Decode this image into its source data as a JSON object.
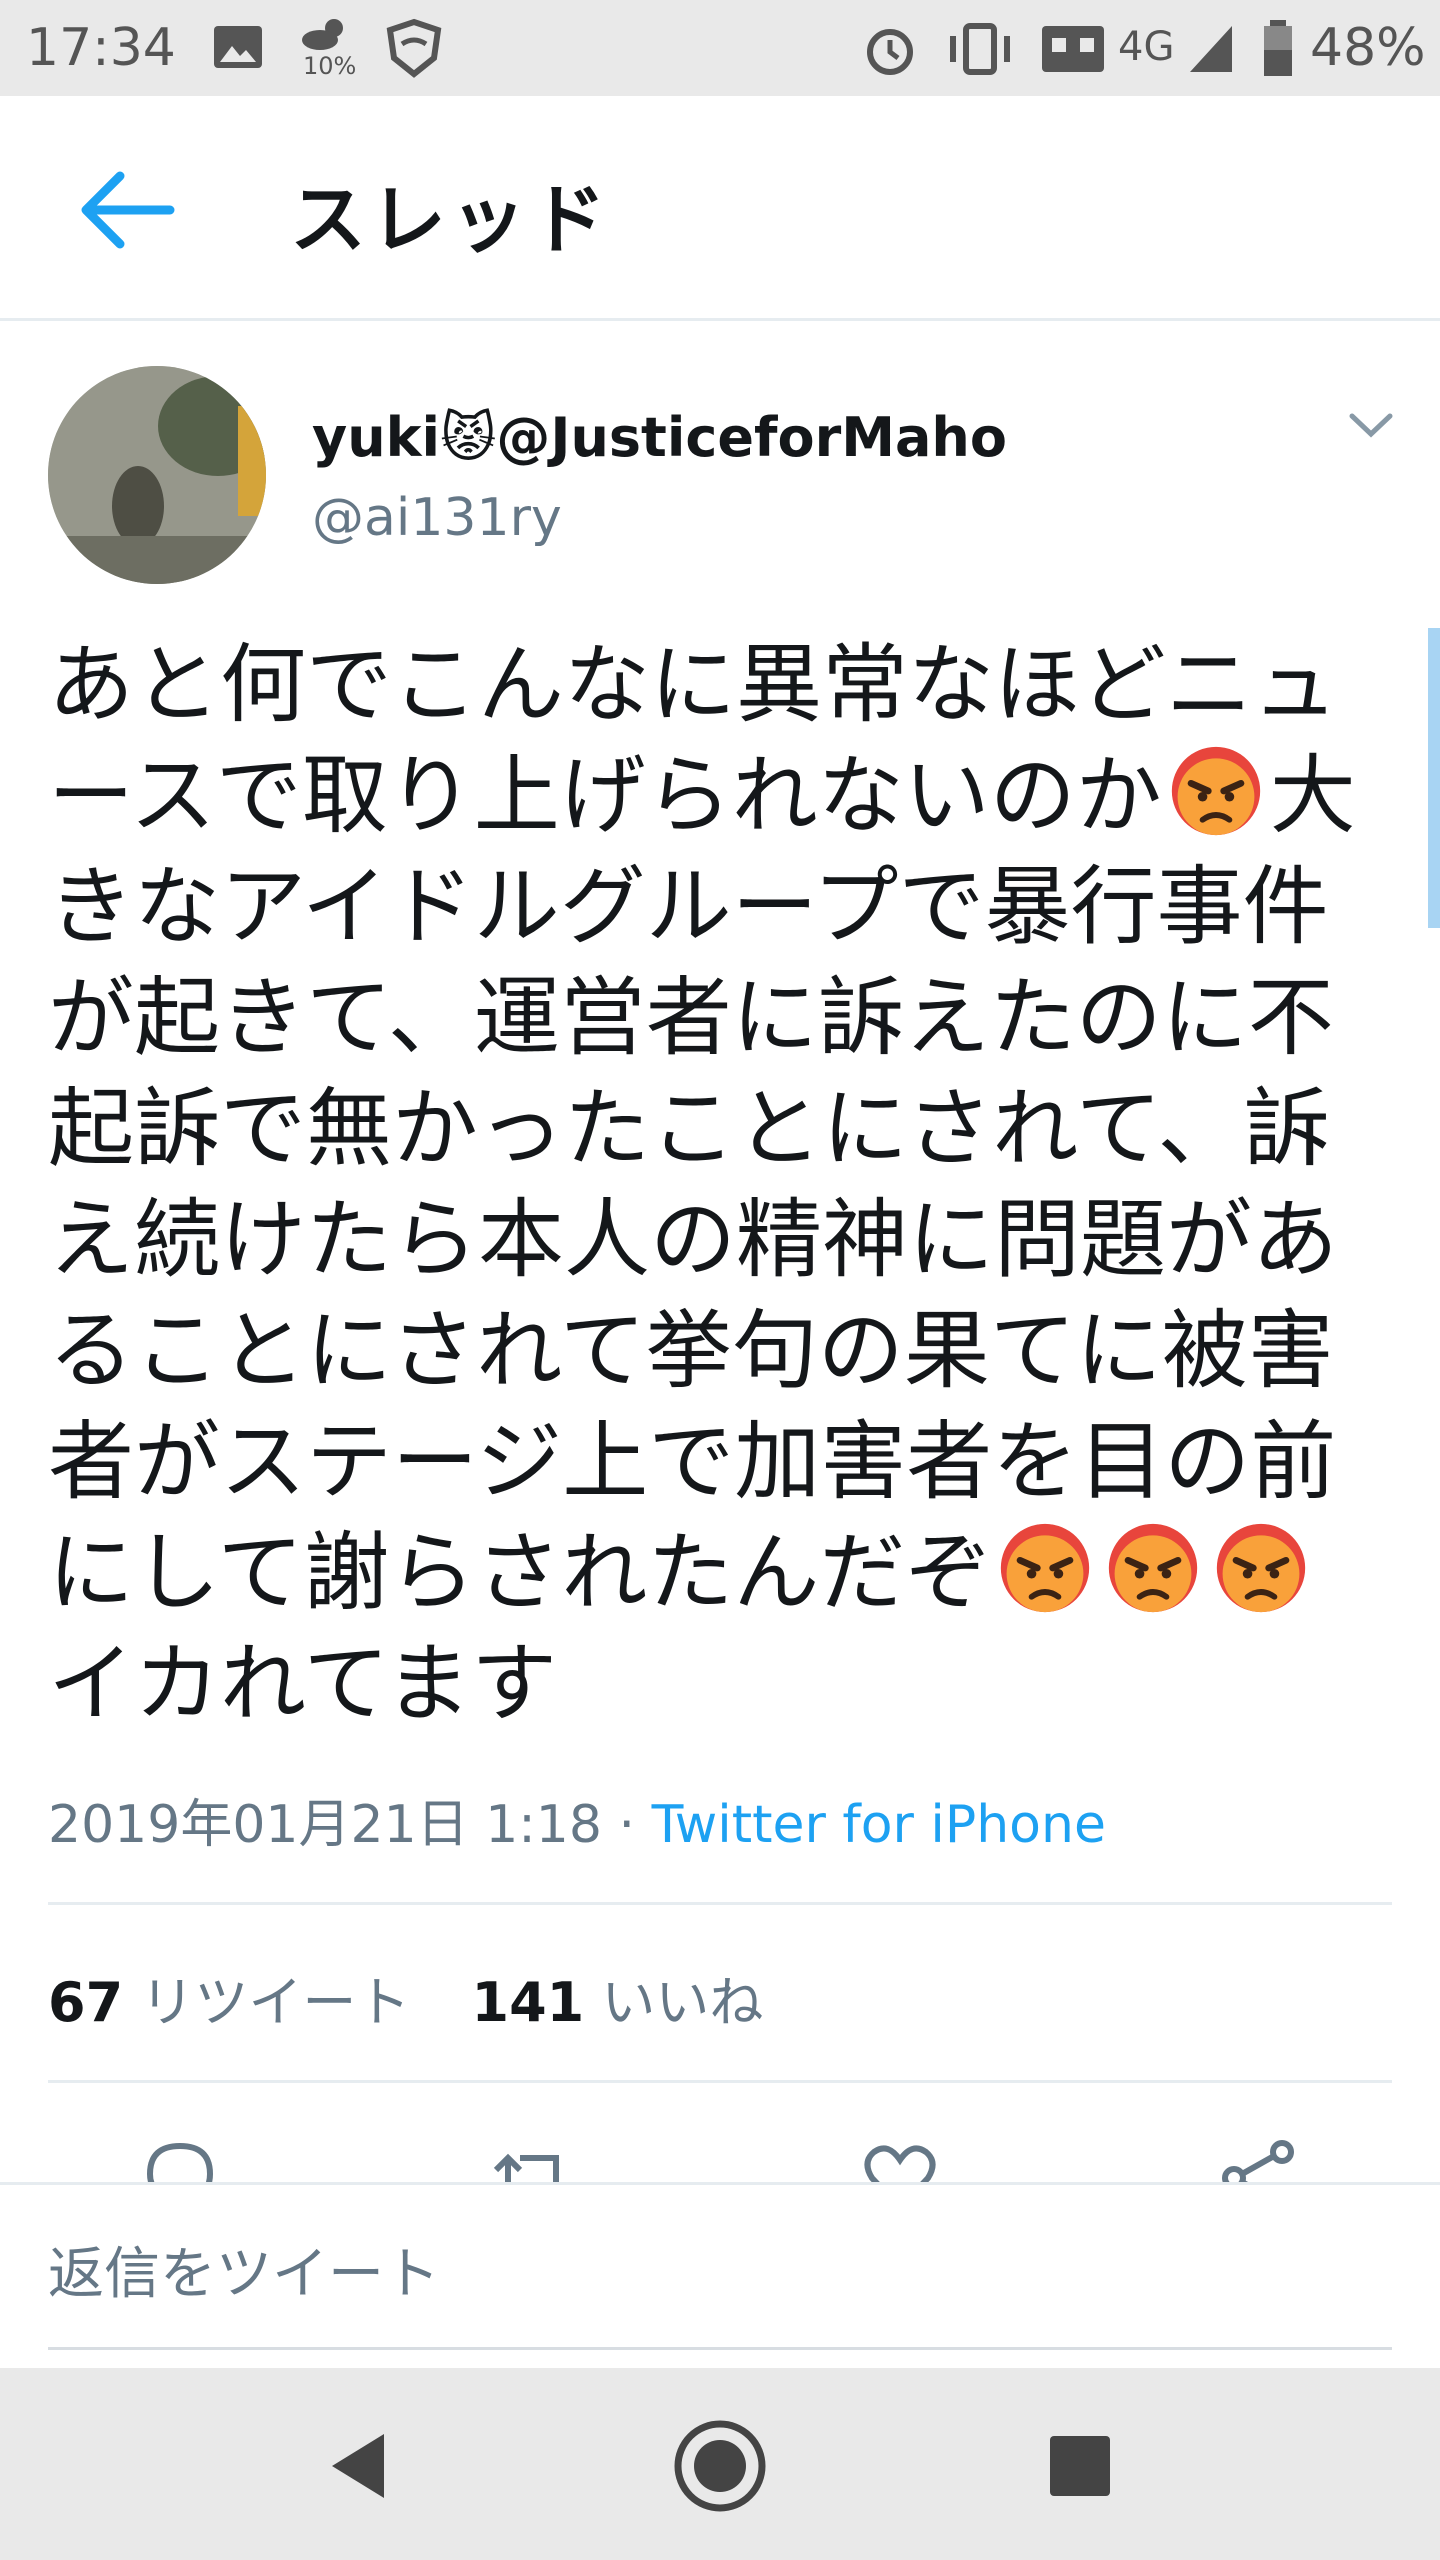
{
  "status_bar": {
    "time": "17:34",
    "weather_percent": "10%",
    "network": "4G",
    "battery": "48%"
  },
  "header": {
    "title": "スレッド"
  },
  "tweet": {
    "display_name": "yuki😾@JusticeforMaho",
    "username": "@ai131ry",
    "text_segments": [
      "あと何でこんなに異常なほどニュースで取り上げられないのか",
      "大きなアイドルグループで暴行事件が起きて、運営者に訴えたのに不起訴で無かったことにされて、訴え続けたら本人の精神に問題があることにされて挙句の果てに被害者がステージ上で加害者を目の前にして謝らされたんだぞ",
      "イカれてます"
    ],
    "timestamp": "2019年01月21日 1:18",
    "separator": " · ",
    "source": "Twitter for iPhone",
    "retweet_count": "67",
    "retweet_label": "リツイート",
    "like_count": "141",
    "like_label": "いいね"
  },
  "reply": {
    "placeholder": "返信をツイート"
  },
  "colors": {
    "accent": "#1da1f2",
    "secondary_text": "#657786",
    "divider": "#e6ecf0"
  },
  "icons": {
    "emoji": "angry-face-emoji",
    "back": "arrow-left-icon"
  }
}
